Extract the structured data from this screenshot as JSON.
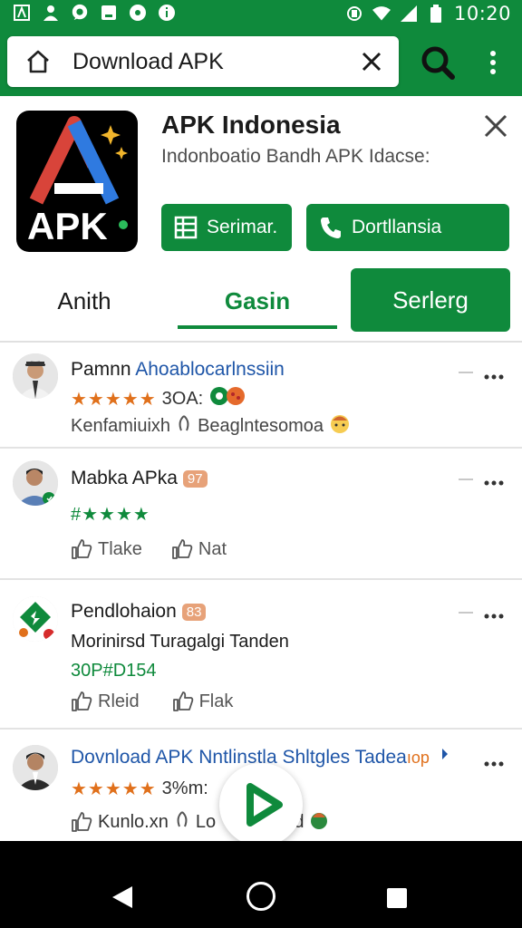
{
  "status_bar": {
    "time": "10:20",
    "left_icons": [
      "a-icon",
      "person-icon",
      "chat-icon",
      "notification-icon",
      "media-icon",
      "info-icon"
    ],
    "right_icons": [
      "rotate-icon",
      "wifi-icon",
      "signal-icon",
      "battery-icon"
    ]
  },
  "browser": {
    "url_text": "Download APK"
  },
  "app": {
    "icon_text": "APK",
    "title": "APK Indonesia",
    "subtitle": "Indonboatio  Bandh APK  Idacse:",
    "button_primary": "Serimar.",
    "button_call": "Dortllansia"
  },
  "tabs": [
    {
      "label": "Anith"
    },
    {
      "label": "Gasin"
    },
    {
      "label": "Serlerg"
    }
  ],
  "reviews": [
    {
      "name": "Pamnn",
      "name_link": "Ahoablocarlnssiin",
      "stars": "★★★★★",
      "meta": "3OA:",
      "detail_a": "Kenfamiuixh",
      "detail_b": "Beaglntesomoa"
    },
    {
      "name": "Mabka APka",
      "badge": "97",
      "stars": "#★★★★",
      "like_1": "Tlake",
      "like_2": "Nat"
    },
    {
      "name": "Pendlohaion",
      "badge": "83",
      "body": "Morinirsd Turagalgi Tanden",
      "green": "30P#D154",
      "like_1": "Rleid",
      "like_2": "Flak"
    },
    {
      "name_link": "Dovnload APK Nntlinstla Shltgles Tadea",
      "name_suffix": "ıop",
      "stars": "★★★★★",
      "meta": "3%m:",
      "detail_a": "Kunlo.xn",
      "detail_b": "Lo",
      "detail_c": "und"
    }
  ],
  "colors": {
    "brand_green": "#0f8a3c",
    "link_blue": "#1f56a8",
    "star_orange": "#e0701b"
  }
}
